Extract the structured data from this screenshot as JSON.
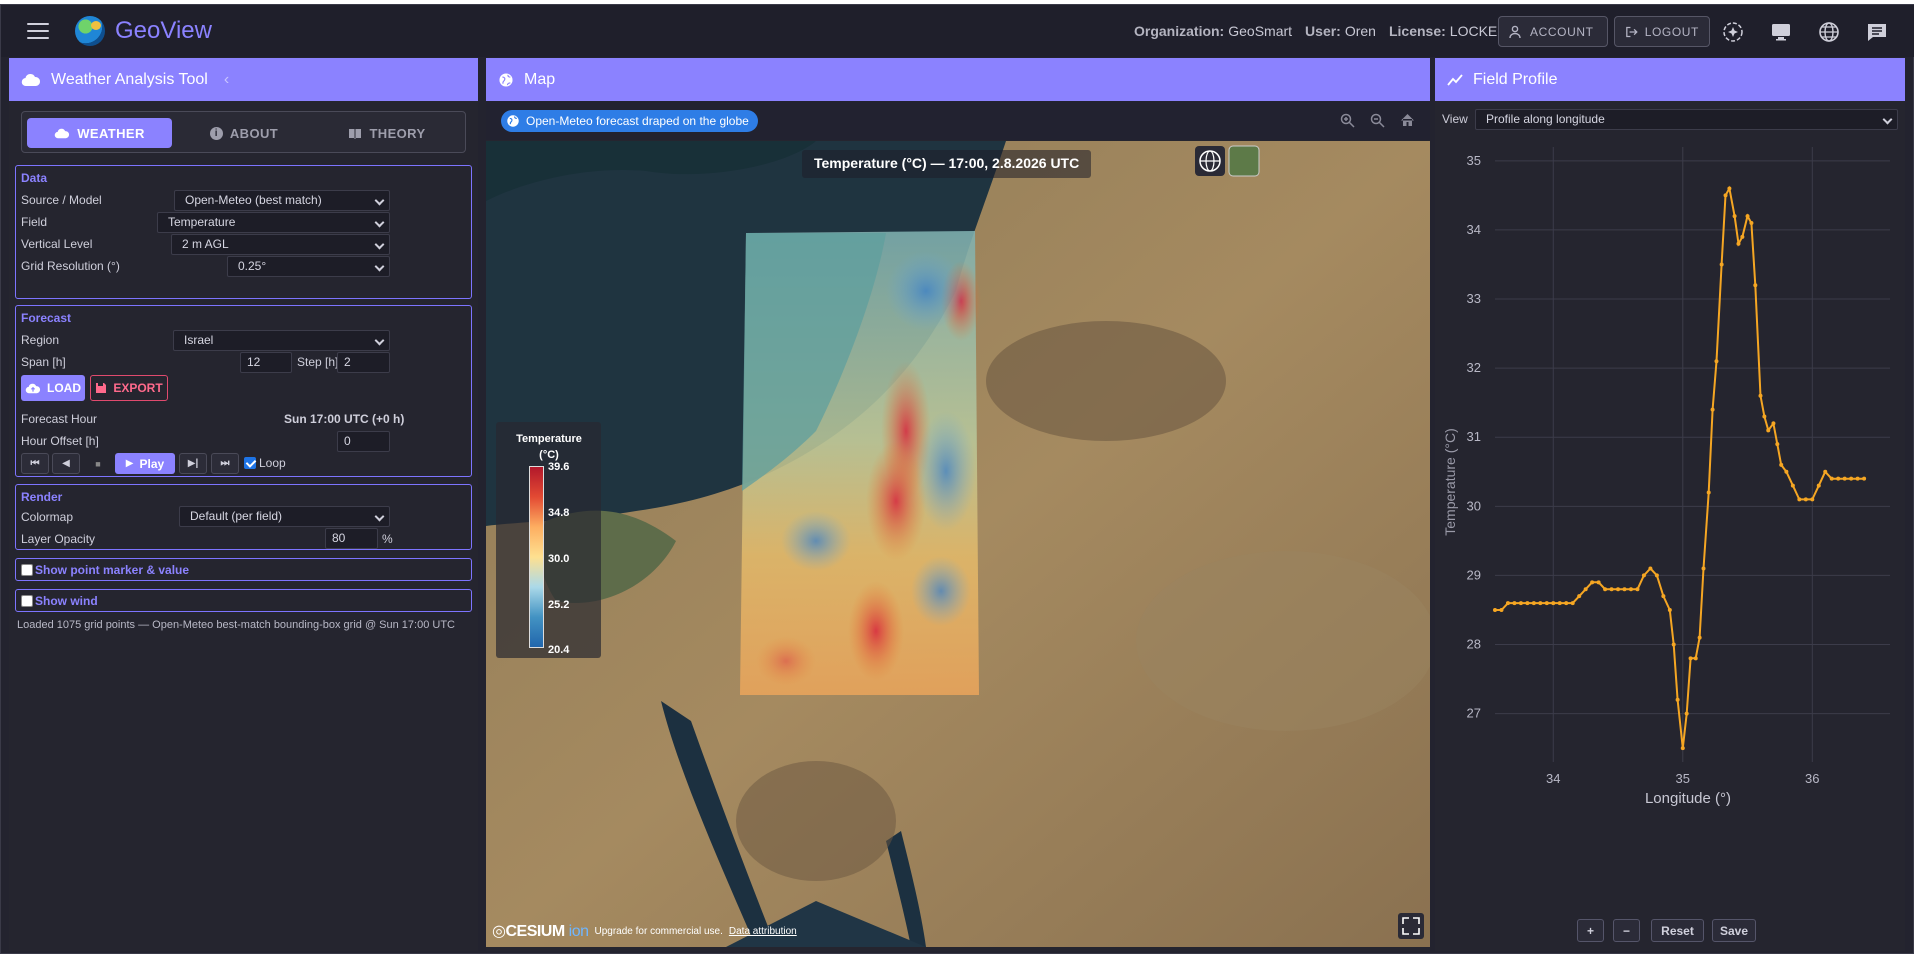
{
  "app": {
    "brand": "GeoView"
  },
  "header": {
    "org_label": "Organization:",
    "org_value": "GeoSmart",
    "user_label": "User:",
    "user_value": "Oren",
    "license_label": "License:",
    "license_value": "LOCKED",
    "account_button": "ACCOUNT",
    "logout_button": "LOGOUT"
  },
  "left": {
    "title": "Weather Analysis Tool",
    "tabs": [
      "WEATHER",
      "ABOUT",
      "THEORY"
    ],
    "data": {
      "title": "Data",
      "source_label": "Source / Model",
      "source_value": "Open-Meteo (best match)",
      "field_label": "Field",
      "field_value": "Temperature",
      "level_label": "Vertical Level",
      "level_value": "2 m AGL",
      "grid_label": "Grid Resolution (°)",
      "grid_value": "0.25°"
    },
    "forecast": {
      "title": "Forecast",
      "region_label": "Region",
      "region_value": "Israel",
      "span_label": "Span [h]",
      "span_value": "12",
      "step_label": "Step [h]",
      "step_value": "2",
      "load_button": "LOAD",
      "export_button": "EXPORT",
      "hour_label": "Forecast Hour",
      "hour_value": "Sun 17:00 UTC (+0 h)",
      "offset_label": "Hour Offset [h]",
      "offset_value": "0",
      "play_button": "Play",
      "loop_label": "Loop",
      "loop_checked": true
    },
    "render": {
      "title": "Render",
      "colormap_label": "Colormap",
      "colormap_value": "Default (per field)",
      "opacity_label": "Layer Opacity",
      "opacity_value": "80",
      "opacity_unit": "%"
    },
    "point_marker_label": "Show point marker & value",
    "wind_label": "Show wind",
    "status": "Loaded 1075 grid points — Open-Meteo best-match bounding-box grid @ Sun 17:00 UTC"
  },
  "map": {
    "title": "Map",
    "chip": "Open-Meteo forecast draped on the globe",
    "overlay_title": "Temperature (°C) — 17:00, 2.8.2026 UTC",
    "legend": {
      "title": "Temperature (°C)",
      "ticks": [
        "39.6",
        "34.8",
        "30.0",
        "25.2",
        "20.4"
      ]
    },
    "cesium_note": "Upgrade for commercial use.",
    "attribution": "Data attribution"
  },
  "right": {
    "title": "Field Profile",
    "view_label": "View",
    "view_value": "Profile along longitude",
    "buttons": [
      "+",
      "−",
      "Reset",
      "Save"
    ]
  },
  "chart_data": {
    "type": "line",
    "xlabel": "Longitude (°)",
    "ylabel": "Temperature (°C)",
    "xlim": [
      33.55,
      36.6
    ],
    "ylim": [
      26.3,
      35.2
    ],
    "xticks": [
      34,
      35,
      36
    ],
    "yticks": [
      27,
      28,
      29,
      30,
      31,
      32,
      33,
      34,
      35
    ],
    "color": "#f5a623",
    "series": [
      {
        "x": [
          33.55,
          33.6,
          33.65,
          33.7,
          33.75,
          33.8,
          33.85,
          33.9,
          33.95,
          34.0,
          34.05,
          34.1,
          34.15,
          34.2,
          34.25,
          34.3,
          34.35,
          34.4,
          34.45,
          34.5,
          34.55,
          34.6,
          34.65,
          34.7,
          34.75,
          34.8,
          34.85,
          34.9,
          34.93,
          34.96,
          35.0,
          35.03,
          35.06,
          35.1,
          35.13,
          35.16,
          35.2,
          35.23,
          35.26,
          35.3,
          35.33,
          35.36,
          35.4,
          35.43,
          35.46,
          35.5,
          35.53,
          35.56,
          35.6,
          35.63,
          35.66,
          35.7,
          35.73,
          35.76,
          35.8,
          35.85,
          35.9,
          35.95,
          36.0,
          36.05,
          36.1,
          36.15,
          36.2,
          36.25,
          36.3,
          36.35,
          36.4
        ],
        "y": [
          28.5,
          28.5,
          28.6,
          28.6,
          28.6,
          28.6,
          28.6,
          28.6,
          28.6,
          28.6,
          28.6,
          28.6,
          28.6,
          28.7,
          28.8,
          28.9,
          28.9,
          28.8,
          28.8,
          28.8,
          28.8,
          28.8,
          28.8,
          29.0,
          29.1,
          29.0,
          28.7,
          28.5,
          28.0,
          27.2,
          26.5,
          27.0,
          27.8,
          27.8,
          28.1,
          29.1,
          30.2,
          31.4,
          32.1,
          33.5,
          34.5,
          34.6,
          34.2,
          33.8,
          33.9,
          34.2,
          34.1,
          33.2,
          31.6,
          31.3,
          31.1,
          31.2,
          30.9,
          30.6,
          30.5,
          30.3,
          30.1,
          30.1,
          30.1,
          30.3,
          30.5,
          30.4,
          30.4,
          30.4,
          30.4,
          30.4,
          30.4
        ]
      }
    ]
  }
}
